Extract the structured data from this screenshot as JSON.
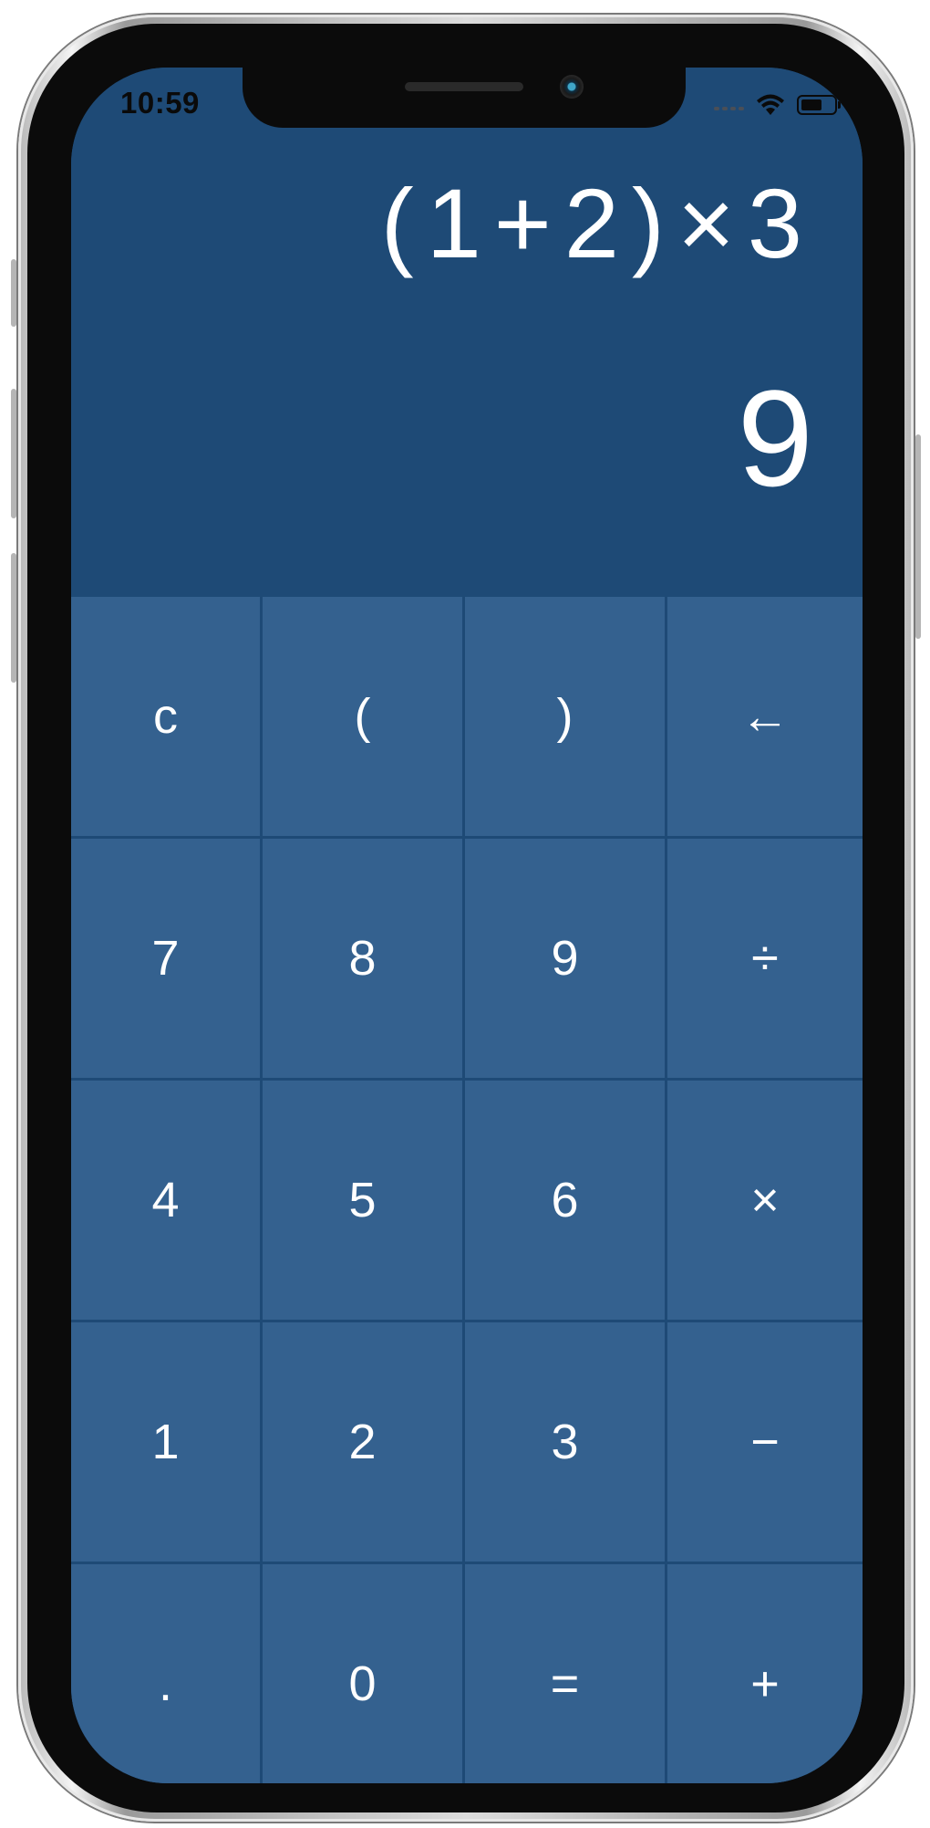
{
  "status_bar": {
    "time": "10:59",
    "icons": [
      "signal-icon",
      "wifi-icon",
      "battery-icon"
    ]
  },
  "display": {
    "expression": "(1+2)×3",
    "result": "9"
  },
  "keypad": {
    "keys": [
      {
        "label": "c",
        "name": "clear-button"
      },
      {
        "label": "(",
        "name": "open-paren-button"
      },
      {
        "label": ")",
        "name": "close-paren-button"
      },
      {
        "label": "←",
        "name": "backspace-button"
      },
      {
        "label": "7",
        "name": "digit-7-button"
      },
      {
        "label": "8",
        "name": "digit-8-button"
      },
      {
        "label": "9",
        "name": "digit-9-button"
      },
      {
        "label": "÷",
        "name": "divide-button"
      },
      {
        "label": "4",
        "name": "digit-4-button"
      },
      {
        "label": "5",
        "name": "digit-5-button"
      },
      {
        "label": "6",
        "name": "digit-6-button"
      },
      {
        "label": "×",
        "name": "multiply-button"
      },
      {
        "label": "1",
        "name": "digit-1-button"
      },
      {
        "label": "2",
        "name": "digit-2-button"
      },
      {
        "label": "3",
        "name": "digit-3-button"
      },
      {
        "label": "−",
        "name": "subtract-button"
      },
      {
        "label": ".",
        "name": "decimal-button"
      },
      {
        "label": "0",
        "name": "digit-0-button"
      },
      {
        "label": "=",
        "name": "equals-button"
      },
      {
        "label": "+",
        "name": "add-button"
      }
    ]
  },
  "colors": {
    "display_background": "#1e4a76",
    "key_background": "#34618f",
    "text": "#ffffff"
  }
}
